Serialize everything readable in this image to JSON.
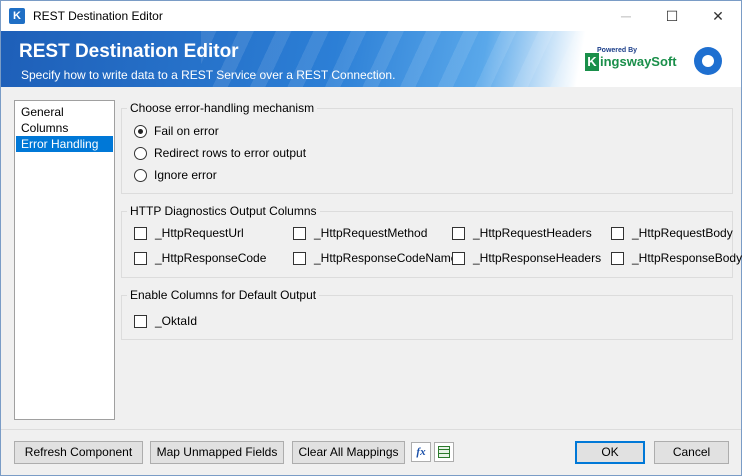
{
  "window": {
    "title": "REST Destination Editor",
    "controls": {
      "minimize": "─",
      "maximize": "☐",
      "close": "✕"
    }
  },
  "banner": {
    "title": "REST Destination Editor",
    "subtitle": "Specify how to write data to a REST Service over a REST Connection.",
    "logo_powered": "Powered By",
    "logo_name": "ingswaySoft",
    "logo_k": "K"
  },
  "nav": {
    "items": [
      {
        "label": "General",
        "selected": false
      },
      {
        "label": "Columns",
        "selected": false
      },
      {
        "label": "Error Handling",
        "selected": true
      }
    ]
  },
  "error_handling": {
    "title": "Choose error-handling mechanism",
    "options": [
      {
        "label": "Fail on error",
        "checked": true
      },
      {
        "label": "Redirect rows to error output",
        "checked": false
      },
      {
        "label": "Ignore error",
        "checked": false
      }
    ]
  },
  "diagnostics": {
    "title": "HTTP Diagnostics Output Columns",
    "columns": [
      {
        "label": "_HttpRequestUrl",
        "checked": false
      },
      {
        "label": "_HttpRequestMethod",
        "checked": false
      },
      {
        "label": "_HttpRequestHeaders",
        "checked": false
      },
      {
        "label": "_HttpRequestBody",
        "checked": false
      },
      {
        "label": "_HttpResponseCode",
        "checked": false
      },
      {
        "label": "_HttpResponseCodeName",
        "checked": false
      },
      {
        "label": "_HttpResponseHeaders",
        "checked": false
      },
      {
        "label": "_HttpResponseBody",
        "checked": false
      }
    ]
  },
  "default_output": {
    "title": "Enable Columns for Default Output",
    "columns": [
      {
        "label": "_OktaId",
        "checked": false
      }
    ]
  },
  "buttons": {
    "refresh": "Refresh Component",
    "map_unmapped": "Map Unmapped Fields",
    "clear_mappings": "Clear All Mappings",
    "fx_icon_text": "fx",
    "ok": "OK",
    "cancel": "Cancel"
  }
}
